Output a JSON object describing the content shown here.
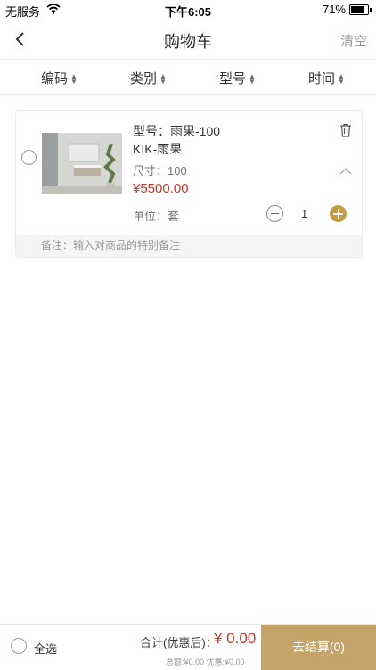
{
  "statusbar": {
    "carrier": "无服务",
    "time": "下午6:05",
    "battery": "71%"
  },
  "navbar": {
    "title": "购物车",
    "clear": "清空"
  },
  "sort": [
    {
      "label": "编码"
    },
    {
      "label": "类别"
    },
    {
      "label": "型号"
    },
    {
      "label": "时间"
    }
  ],
  "cart": {
    "item": {
      "model": "型号：雨果-100",
      "name": "KIK-雨果",
      "size": "尺寸：100",
      "price": "¥5500.00",
      "unit": "单位：套",
      "quantity": "1",
      "remark": "备注：输入对商品的特别备注"
    }
  },
  "footer": {
    "select_all": "全选",
    "total_label": "合计(优惠后)：",
    "total_value": "¥ 0.00",
    "sub": "总额:¥0.00 优惠:¥0.00",
    "checkout": "去结算(0)"
  },
  "colors": {
    "accent": "#c4a468",
    "price": "#c0392b"
  }
}
